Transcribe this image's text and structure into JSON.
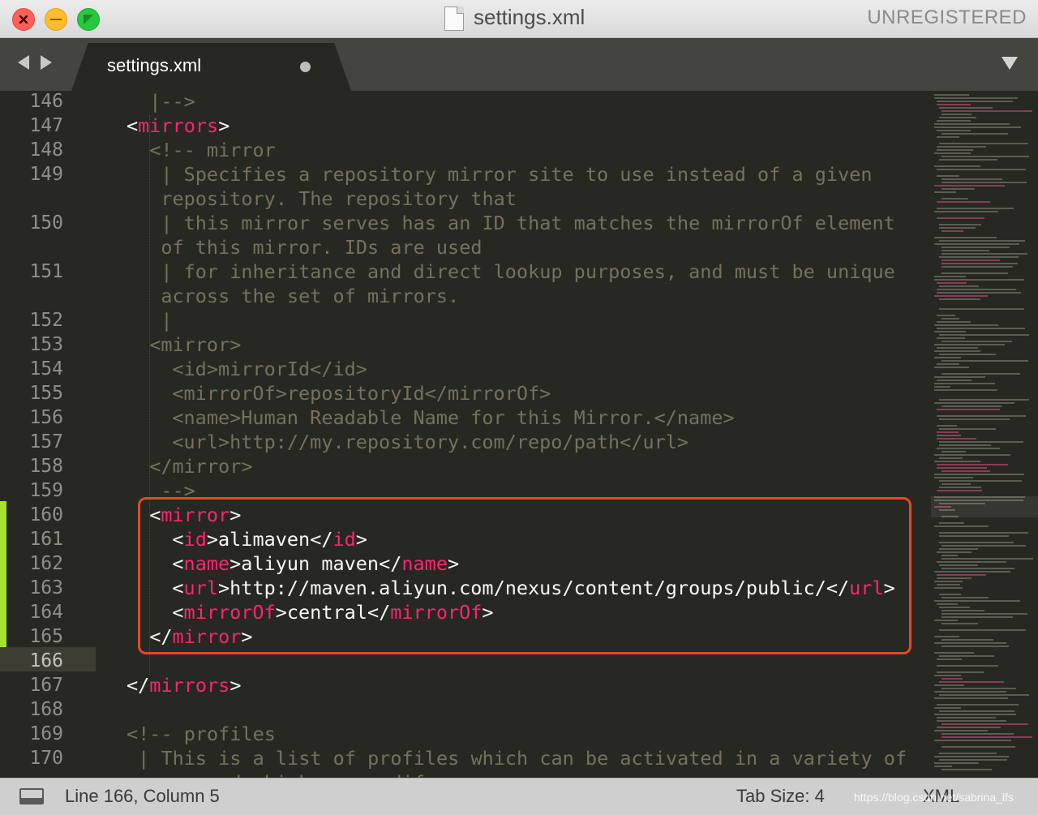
{
  "window": {
    "title": "settings.xml",
    "license_status": "UNREGISTERED"
  },
  "tabs": [
    {
      "label": "settings.xml",
      "modified": true
    }
  ],
  "editor": {
    "current_line": 166,
    "lines": [
      {
        "no": "146",
        "indent": 1,
        "parts": [
          [
            "cmt",
            "|-->"
          ]
        ]
      },
      {
        "no": "147",
        "indent": 0,
        "parts": [
          [
            "pun",
            "<"
          ],
          [
            "tag",
            "mirrors"
          ],
          [
            "pun",
            ">"
          ]
        ]
      },
      {
        "no": "148",
        "indent": 1,
        "parts": [
          [
            "cmt",
            "<!-- mirror"
          ]
        ]
      },
      {
        "no": "149",
        "indent": 1,
        "parts": [
          [
            "cmt",
            " | Specifies a repository mirror site to use instead of a given"
          ]
        ]
      },
      {
        "no": "",
        "indent": 1,
        "parts": [
          [
            "cmt",
            " repository. The repository that"
          ]
        ]
      },
      {
        "no": "150",
        "indent": 1,
        "parts": [
          [
            "cmt",
            " | this mirror serves has an ID that matches the mirrorOf element"
          ]
        ]
      },
      {
        "no": "",
        "indent": 1,
        "parts": [
          [
            "cmt",
            " of this mirror. IDs are used"
          ]
        ]
      },
      {
        "no": "151",
        "indent": 1,
        "parts": [
          [
            "cmt",
            " | for inheritance and direct lookup purposes, and must be unique"
          ]
        ]
      },
      {
        "no": "",
        "indent": 1,
        "parts": [
          [
            "cmt",
            " across the set of mirrors."
          ]
        ]
      },
      {
        "no": "152",
        "indent": 1,
        "parts": [
          [
            "cmt",
            " |"
          ]
        ]
      },
      {
        "no": "153",
        "indent": 1,
        "parts": [
          [
            "cmt",
            "<mirror>"
          ]
        ]
      },
      {
        "no": "154",
        "indent": 2,
        "parts": [
          [
            "cmt",
            "<id>mirrorId</id>"
          ]
        ]
      },
      {
        "no": "155",
        "indent": 2,
        "parts": [
          [
            "cmt",
            "<mirrorOf>repositoryId</mirrorOf>"
          ]
        ]
      },
      {
        "no": "156",
        "indent": 2,
        "parts": [
          [
            "cmt",
            "<name>Human Readable Name for this Mirror.</name>"
          ]
        ]
      },
      {
        "no": "157",
        "indent": 2,
        "parts": [
          [
            "cmt",
            "<url>http://my.repository.com/repo/path</url>"
          ]
        ]
      },
      {
        "no": "158",
        "indent": 1,
        "parts": [
          [
            "cmt",
            "</mirror>"
          ]
        ]
      },
      {
        "no": "159",
        "indent": 1,
        "parts": [
          [
            "cmt",
            " -->"
          ]
        ]
      },
      {
        "no": "160",
        "indent": 1,
        "parts": [
          [
            "pun",
            "<"
          ],
          [
            "tag",
            "mirror"
          ],
          [
            "pun",
            ">"
          ]
        ]
      },
      {
        "no": "161",
        "indent": 2,
        "parts": [
          [
            "pun",
            "<"
          ],
          [
            "tag",
            "id"
          ],
          [
            "pun",
            ">"
          ],
          [
            "txt",
            "alimaven"
          ],
          [
            "pun",
            "</"
          ],
          [
            "tag",
            "id"
          ],
          [
            "pun",
            ">"
          ]
        ]
      },
      {
        "no": "162",
        "indent": 2,
        "parts": [
          [
            "pun",
            "<"
          ],
          [
            "tag",
            "name"
          ],
          [
            "pun",
            ">"
          ],
          [
            "txt",
            "aliyun maven"
          ],
          [
            "pun",
            "</"
          ],
          [
            "tag",
            "name"
          ],
          [
            "pun",
            ">"
          ]
        ]
      },
      {
        "no": "163",
        "indent": 2,
        "parts": [
          [
            "pun",
            "<"
          ],
          [
            "tag",
            "url"
          ],
          [
            "pun",
            ">"
          ],
          [
            "txt",
            "http://maven.aliyun.com/nexus/content/groups/public/"
          ],
          [
            "pun",
            "</"
          ],
          [
            "tag",
            "url"
          ],
          [
            "pun",
            ">"
          ]
        ]
      },
      {
        "no": "164",
        "indent": 2,
        "parts": [
          [
            "pun",
            "<"
          ],
          [
            "tag",
            "mirrorOf"
          ],
          [
            "pun",
            ">"
          ],
          [
            "txt",
            "central"
          ],
          [
            "pun",
            "</"
          ],
          [
            "tag",
            "mirrorOf"
          ],
          [
            "pun",
            ">"
          ]
        ]
      },
      {
        "no": "165",
        "indent": 1,
        "parts": [
          [
            "pun",
            "</"
          ],
          [
            "tag",
            "mirror"
          ],
          [
            "pun",
            ">"
          ]
        ]
      },
      {
        "no": "166",
        "indent": 1,
        "parts": []
      },
      {
        "no": "167",
        "indent": 0,
        "parts": [
          [
            "pun",
            "</"
          ],
          [
            "tag",
            "mirrors"
          ],
          [
            "pun",
            ">"
          ]
        ]
      },
      {
        "no": "168",
        "indent": 0,
        "parts": []
      },
      {
        "no": "169",
        "indent": 0,
        "parts": [
          [
            "cmt",
            "<!-- profiles"
          ]
        ]
      },
      {
        "no": "170",
        "indent": 0,
        "parts": [
          [
            "cmt",
            " | This is a list of profiles which can be activated in a variety of"
          ]
        ]
      },
      {
        "no": "",
        "indent": 0,
        "parts": [
          [
            "cmt",
            " ways, and which can modify"
          ]
        ]
      }
    ]
  },
  "status": {
    "position": "Line 166, Column 5",
    "tab_size": "Tab Size: 4",
    "syntax": "XML",
    "watermark": "https://blog.csdn.net/sabrina_lfs"
  },
  "colors": {
    "background": "#272822",
    "comment": "#75715e",
    "tag": "#f92672",
    "text": "#f8f8f2",
    "modified_gutter": "#a6e22e",
    "highlight_box": "#e5452e"
  },
  "icons": {
    "back": "arrow-left-icon",
    "forward": "arrow-right-icon",
    "tab_menu": "chevron-down-icon",
    "panel": "panel-toggle-icon",
    "file": "document-icon"
  }
}
